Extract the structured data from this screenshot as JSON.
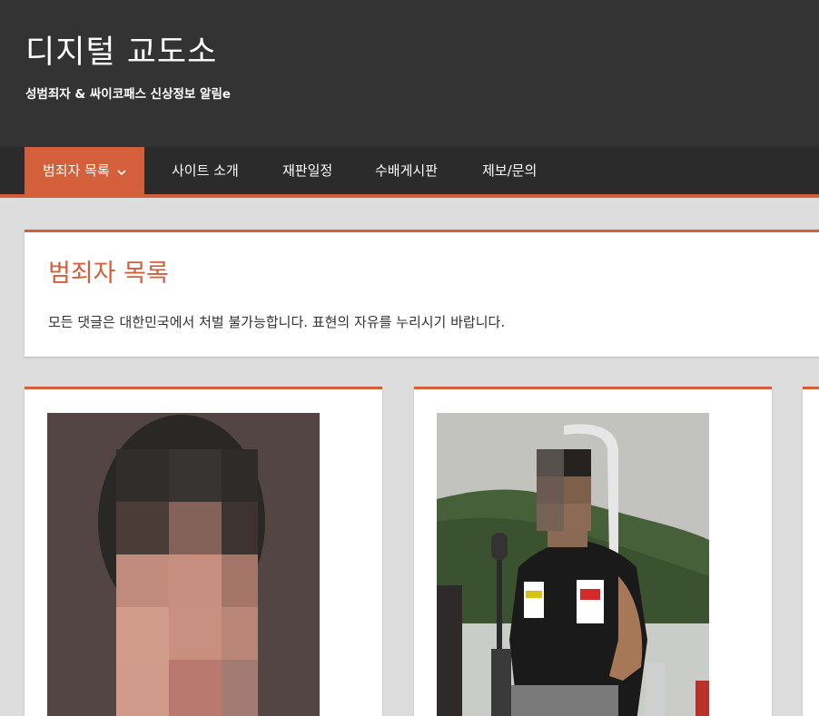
{
  "site": {
    "title": "디지털 교도소",
    "description": "성범죄자 & 싸이코패스 신상정보 알림e"
  },
  "nav": {
    "items": [
      {
        "label": "범죄자 목록",
        "has_dropdown": true,
        "active": true
      },
      {
        "label": "사이트 소개"
      },
      {
        "label": "재판일정"
      },
      {
        "label": "수배게시판"
      },
      {
        "label": "제보/문의"
      }
    ]
  },
  "intro": {
    "title": "범죄자 목록",
    "text": "모든 댓글은 대한민국에서 처벌 불가능합니다. 표현의 자유를 누리시기 바랍니다."
  },
  "colors": {
    "accent": "#d35f3b",
    "header_bg": "#333333",
    "nav_bg": "#2b2b2b",
    "page_bg": "#dddddd"
  },
  "cards": [
    {
      "image": "pixelated-face-portrait"
    },
    {
      "image": "pixelated-face-man-in-black-shirt-outdoors"
    },
    {
      "image": "partially-visible-card"
    }
  ]
}
